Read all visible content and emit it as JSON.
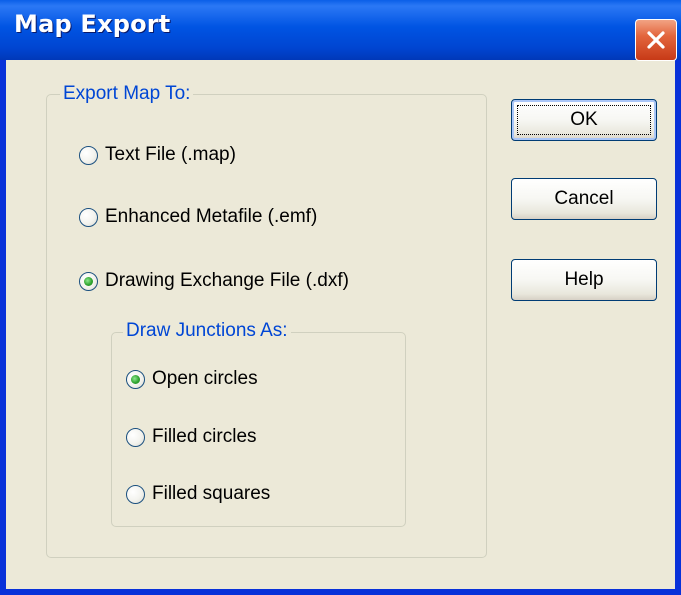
{
  "window": {
    "title": "Map Export",
    "close_icon": "close-icon"
  },
  "export_group": {
    "label": "Export Map To:",
    "options": [
      {
        "label": "Text File (.map)",
        "checked": false
      },
      {
        "label": "Enhanced Metafile (.emf)",
        "checked": false
      },
      {
        "label": "Drawing Exchange File (.dxf)",
        "checked": true
      }
    ]
  },
  "junction_group": {
    "label": "Draw Junctions As:",
    "options": [
      {
        "label": "Open circles",
        "checked": true
      },
      {
        "label": "Filled circles",
        "checked": false
      },
      {
        "label": "Filled squares",
        "checked": false
      }
    ]
  },
  "buttons": {
    "ok": "OK",
    "cancel": "Cancel",
    "help": "Help"
  },
  "colors": {
    "titlebar": "#0054e3",
    "dialog_bg": "#ece9d8",
    "group_label": "#0046d5",
    "radio_checked": "#31a531",
    "close_button": "#e3653d"
  }
}
